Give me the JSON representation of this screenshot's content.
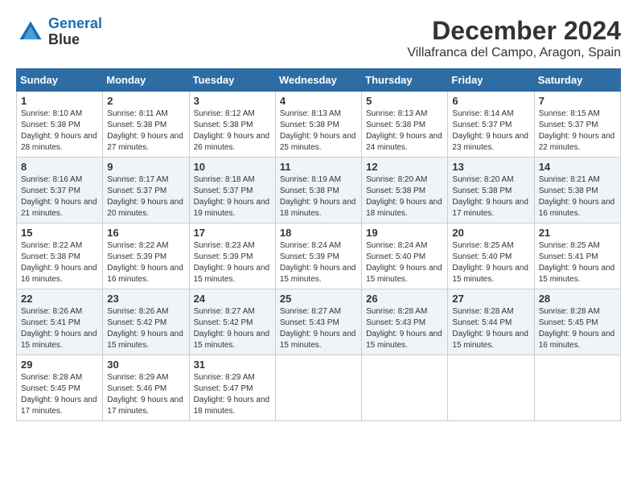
{
  "header": {
    "logo_line1": "General",
    "logo_line2": "Blue",
    "title": "December 2024",
    "subtitle": "Villafranca del Campo, Aragon, Spain"
  },
  "days_of_week": [
    "Sunday",
    "Monday",
    "Tuesday",
    "Wednesday",
    "Thursday",
    "Friday",
    "Saturday"
  ],
  "weeks": [
    [
      {
        "day": "1",
        "sunrise": "8:10 AM",
        "sunset": "5:38 PM",
        "daylight": "9 hours and 28 minutes."
      },
      {
        "day": "2",
        "sunrise": "8:11 AM",
        "sunset": "5:38 PM",
        "daylight": "9 hours and 27 minutes."
      },
      {
        "day": "3",
        "sunrise": "8:12 AM",
        "sunset": "5:38 PM",
        "daylight": "9 hours and 26 minutes."
      },
      {
        "day": "4",
        "sunrise": "8:13 AM",
        "sunset": "5:38 PM",
        "daylight": "9 hours and 25 minutes."
      },
      {
        "day": "5",
        "sunrise": "8:13 AM",
        "sunset": "5:38 PM",
        "daylight": "9 hours and 24 minutes."
      },
      {
        "day": "6",
        "sunrise": "8:14 AM",
        "sunset": "5:37 PM",
        "daylight": "9 hours and 23 minutes."
      },
      {
        "day": "7",
        "sunrise": "8:15 AM",
        "sunset": "5:37 PM",
        "daylight": "9 hours and 22 minutes."
      }
    ],
    [
      {
        "day": "8",
        "sunrise": "8:16 AM",
        "sunset": "5:37 PM",
        "daylight": "9 hours and 21 minutes."
      },
      {
        "day": "9",
        "sunrise": "8:17 AM",
        "sunset": "5:37 PM",
        "daylight": "9 hours and 20 minutes."
      },
      {
        "day": "10",
        "sunrise": "8:18 AM",
        "sunset": "5:37 PM",
        "daylight": "9 hours and 19 minutes."
      },
      {
        "day": "11",
        "sunrise": "8:19 AM",
        "sunset": "5:38 PM",
        "daylight": "9 hours and 18 minutes."
      },
      {
        "day": "12",
        "sunrise": "8:20 AM",
        "sunset": "5:38 PM",
        "daylight": "9 hours and 18 minutes."
      },
      {
        "day": "13",
        "sunrise": "8:20 AM",
        "sunset": "5:38 PM",
        "daylight": "9 hours and 17 minutes."
      },
      {
        "day": "14",
        "sunrise": "8:21 AM",
        "sunset": "5:38 PM",
        "daylight": "9 hours and 16 minutes."
      }
    ],
    [
      {
        "day": "15",
        "sunrise": "8:22 AM",
        "sunset": "5:38 PM",
        "daylight": "9 hours and 16 minutes."
      },
      {
        "day": "16",
        "sunrise": "8:22 AM",
        "sunset": "5:39 PM",
        "daylight": "9 hours and 16 minutes."
      },
      {
        "day": "17",
        "sunrise": "8:23 AM",
        "sunset": "5:39 PM",
        "daylight": "9 hours and 15 minutes."
      },
      {
        "day": "18",
        "sunrise": "8:24 AM",
        "sunset": "5:39 PM",
        "daylight": "9 hours and 15 minutes."
      },
      {
        "day": "19",
        "sunrise": "8:24 AM",
        "sunset": "5:40 PM",
        "daylight": "9 hours and 15 minutes."
      },
      {
        "day": "20",
        "sunrise": "8:25 AM",
        "sunset": "5:40 PM",
        "daylight": "9 hours and 15 minutes."
      },
      {
        "day": "21",
        "sunrise": "8:25 AM",
        "sunset": "5:41 PM",
        "daylight": "9 hours and 15 minutes."
      }
    ],
    [
      {
        "day": "22",
        "sunrise": "8:26 AM",
        "sunset": "5:41 PM",
        "daylight": "9 hours and 15 minutes."
      },
      {
        "day": "23",
        "sunrise": "8:26 AM",
        "sunset": "5:42 PM",
        "daylight": "9 hours and 15 minutes."
      },
      {
        "day": "24",
        "sunrise": "8:27 AM",
        "sunset": "5:42 PM",
        "daylight": "9 hours and 15 minutes."
      },
      {
        "day": "25",
        "sunrise": "8:27 AM",
        "sunset": "5:43 PM",
        "daylight": "9 hours and 15 minutes."
      },
      {
        "day": "26",
        "sunrise": "8:28 AM",
        "sunset": "5:43 PM",
        "daylight": "9 hours and 15 minutes."
      },
      {
        "day": "27",
        "sunrise": "8:28 AM",
        "sunset": "5:44 PM",
        "daylight": "9 hours and 15 minutes."
      },
      {
        "day": "28",
        "sunrise": "8:28 AM",
        "sunset": "5:45 PM",
        "daylight": "9 hours and 16 minutes."
      }
    ],
    [
      {
        "day": "29",
        "sunrise": "8:28 AM",
        "sunset": "5:45 PM",
        "daylight": "9 hours and 17 minutes."
      },
      {
        "day": "30",
        "sunrise": "8:29 AM",
        "sunset": "5:46 PM",
        "daylight": "9 hours and 17 minutes."
      },
      {
        "day": "31",
        "sunrise": "8:29 AM",
        "sunset": "5:47 PM",
        "daylight": "9 hours and 18 minutes."
      },
      null,
      null,
      null,
      null
    ]
  ]
}
